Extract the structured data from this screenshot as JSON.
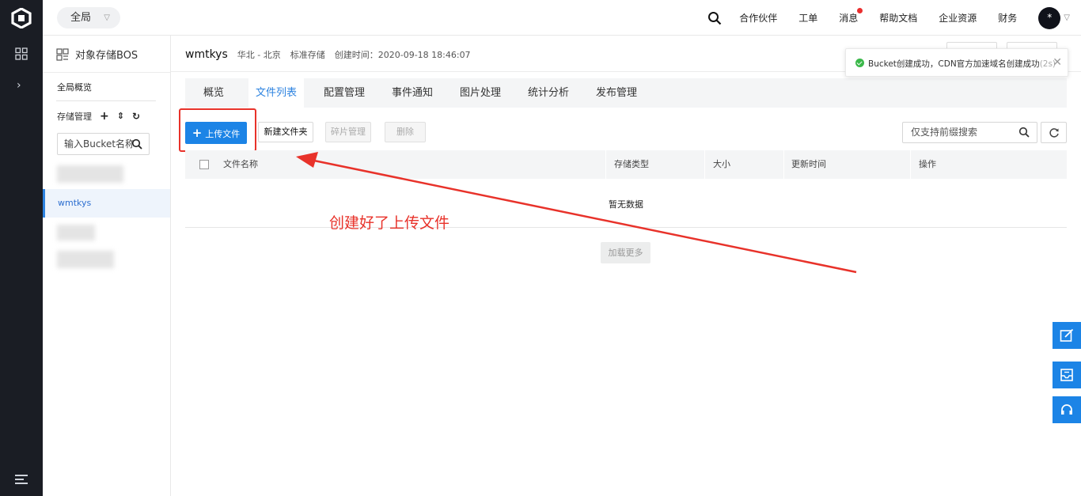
{
  "header": {
    "region": "全局",
    "nav": [
      "合作伙伴",
      "工单",
      "消息",
      "帮助文档",
      "企业资源",
      "财务"
    ],
    "avatar_text": "*"
  },
  "sidebar": {
    "product": "对象存储BOS",
    "overview": "全局概览",
    "storage_label": "存储管理",
    "bucket_search_value": "输入Bucket名称",
    "active_bucket": "wmtkys"
  },
  "bucket": {
    "name": "wmtkys",
    "region": "华北 - 北京",
    "storage_class": "标准存储",
    "created": "创建时间：2020-09-18 18:46:07"
  },
  "tabs": [
    "概览",
    "文件列表",
    "配置管理",
    "事件通知",
    "图片处理",
    "统计分析",
    "发布管理"
  ],
  "active_tab_index": 1,
  "toolbar": {
    "upload": "上传文件",
    "new_folder": "新建文件夹",
    "fragment": "碎片管理",
    "delete": "删除",
    "search_placeholder": "仅支持前缀搜索"
  },
  "table": {
    "columns": [
      "文件名称",
      "存储类型",
      "大小",
      "更新时间",
      "操作"
    ],
    "empty": "暂无数据",
    "load_more": "加载更多"
  },
  "annotation": "创建好了上传文件",
  "toast": {
    "message": "Bucket创建成功，CDN官方加速域名创建成功",
    "timer": "(2s)"
  },
  "colors": {
    "primary": "#1c84e6",
    "annotation": "#e8322a",
    "rail": "#1a1d24",
    "badge": "#ea2e2e"
  }
}
